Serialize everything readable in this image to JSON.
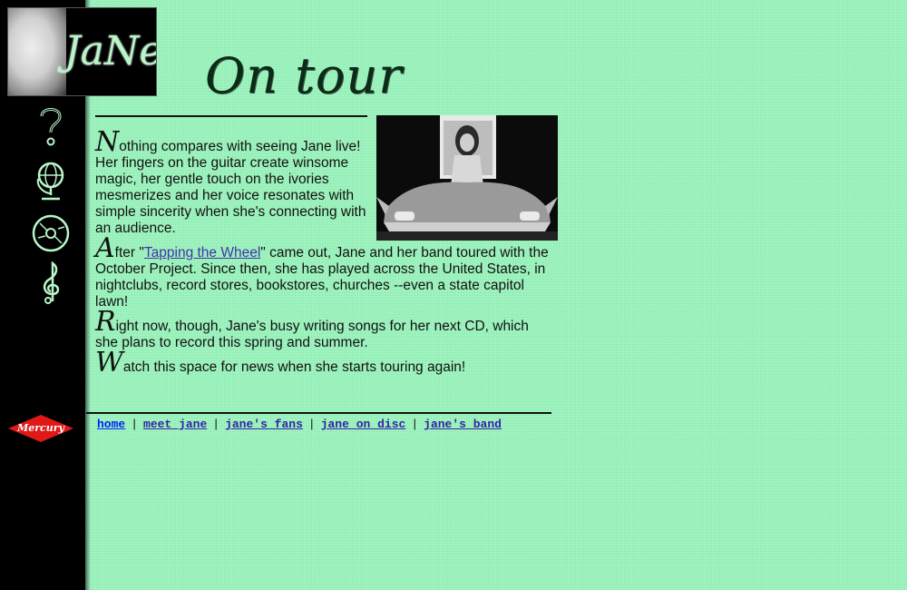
{
  "logo": {
    "text": "JaNe"
  },
  "page_title": "On tour",
  "paragraphs": [
    {
      "cap": "N",
      "before": "othing compares with seeing Jane live! Her fingers on the guitar create winsome magic, her gentle touch on the ivories mesmerizes and her voice resonates with simple sincerity when she's connecting with an audience.",
      "link": "",
      "after": ""
    },
    {
      "cap": "A",
      "before": "fter \"",
      "link": "Tapping the Wheel",
      "after": "\" came out, Jane and her band toured with the October Project. Since then, she has played across the United States, in nightclubs, record stores, bookstores, churches --even a state capitol lawn!"
    },
    {
      "cap": "R",
      "before": "ight now, though, Jane's busy writing songs for her next CD, which she plans to record this spring and summer.",
      "link": "",
      "after": ""
    },
    {
      "cap": "W",
      "before": "atch this space for news when she starts touring again!",
      "link": "",
      "after": ""
    }
  ],
  "footer_nav": {
    "home": "home",
    "meet": "meet jane",
    "fans": "jane's fans",
    "disc": "jane on disc",
    "band": "jane's band",
    "separator": "|"
  },
  "mercury_logo": {
    "text": "Mercury"
  },
  "icons": [
    "question-mark-icon",
    "globe-icon",
    "cd-disc-icon",
    "treble-clef-icon"
  ],
  "colors": {
    "background": "#9df2bd",
    "sidebar": "#000000",
    "link": "#3322aa",
    "icon": "#b8f5c8"
  }
}
